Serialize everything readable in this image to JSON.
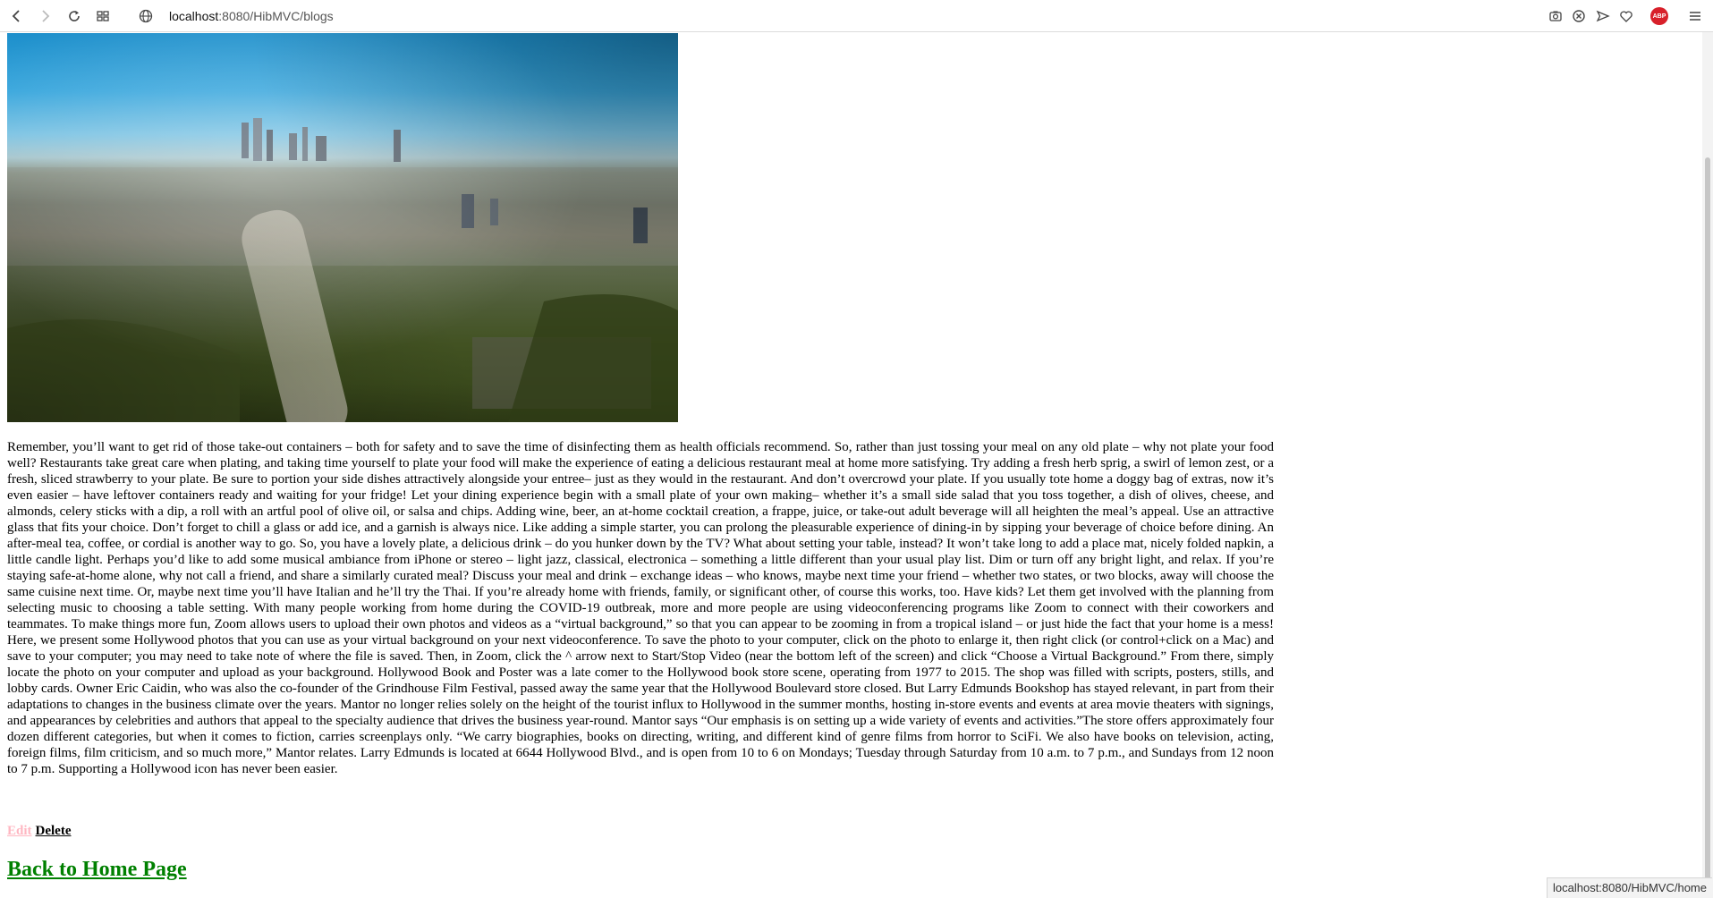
{
  "browser": {
    "url_host": "localhost",
    "url_path": ":8080/HibMVC/blogs",
    "adblock_badge": "ABP",
    "status_url": "localhost:8080/HibMVC/home"
  },
  "article": {
    "body": "Remember, you’ll want to get rid of those take-out containers – both for safety and to save the time of disinfecting them as health officials recommend. So, rather than just tossing your meal on any old plate – why not plate your food well? Restaurants take great care when plating, and taking time yourself to plate your food will make the experience of eating a delicious restaurant meal at home more satisfying. Try adding a fresh herb sprig, a swirl of lemon zest, or a fresh, sliced strawberry to your plate. Be sure to portion your side dishes attractively alongside your entree– just as they would in the restaurant. And don’t overcrowd your plate. If you usually tote home a doggy bag of extras, now it’s even easier – have leftover containers ready and waiting for your fridge! Let your dining experience begin with a small plate of your own making– whether it’s a small side salad that you toss together, a dish of olives, cheese, and almonds, celery sticks with a dip, a roll with an artful pool of olive oil, or salsa and chips. Adding wine, beer, an at-home cocktail creation, a frappe, juice, or take-out adult beverage will all heighten the meal’s appeal. Use an attractive glass that fits your choice. Don’t forget to chill a glass or add ice, and a garnish is always nice. Like adding a simple starter, you can prolong the pleasurable experience of dining-in by sipping your beverage of choice before dining. An after-meal tea, coffee, or cordial is another way to go. So, you have a lovely plate, a delicious drink – do you hunker down by the TV? What about setting your table, instead? It won’t take long to add a place mat, nicely folded napkin, a little candle light. Perhaps you’d like to add some musical ambiance from iPhone or stereo – light jazz, classical, electronica – something a little different than your usual play list. Dim or turn off any bright light, and relax. If you’re staying safe-at-home alone, why not call a friend, and share a similarly curated meal? Discuss your meal and drink – exchange ideas – who knows, maybe next time your friend – whether two states, or two blocks, away will choose the same cuisine next time. Or, maybe next time you’ll have Italian and he’ll try the Thai. If you’re already home with friends, family, or significant other, of course this works, too. Have kids? Let them get involved with the planning from selecting music to choosing a table setting. With many people working from home during the COVID-19 outbreak, more and more people are using videoconferencing programs like Zoom to connect with their coworkers and teammates. To make things more fun, Zoom allows users to upload their own photos and videos as a “virtual background,” so that you can appear to be zooming in from a tropical island – or just hide the fact that your home is a mess! Here, we present some Hollywood photos that you can use as your virtual background on your next videoconference. To save the photo to your computer, click on the photo to enlarge it, then right click (or control+click on a Mac) and save to your computer; you may need to take note of where the file is saved. Then, in Zoom, click the ^ arrow next to Start/Stop Video (near the bottom left of the screen) and click “Choose a Virtual Background.” From there, simply locate the photo on your computer and upload as your background. Hollywood Book and Poster was a late comer to the Hollywood book store scene, operating from 1977 to 2015. The shop was filled with scripts, posters, stills, and lobby cards. Owner Eric Caidin, who was also the co-founder of the Grindhouse Film Festival, passed away the same year that the Hollywood Boulevard store closed. But Larry Edmunds Bookshop has stayed relevant, in part from their adaptations to changes in the business climate over the years. Mantor no longer relies solely on the height of the tourist influx to Hollywood in the summer months, hosting in-store events and events at area movie theaters with signings, and appearances by celebrities and authors that appeal to the specialty audience that drives the business year-round. Mantor says “Our emphasis is on setting up a wide variety of events and activities.”The store offers approximately four dozen different categories, but when it comes to fiction, carries screenplays only. “We carry biographies, books on directing, writing, and different kind of genre films from horror to SciFi. We also have books on television, acting, foreign films, film criticism, and so much more,” Mantor relates. Larry Edmunds is located at 6644 Hollywood Blvd., and is open from 10 to 6 on Mondays; Tuesday through Saturday from 10 a.m. to 7 p.m., and Sundays from 12 noon to 7 p.m. Supporting a Hollywood icon has never been easier."
  },
  "actions": {
    "edit_label": "Edit",
    "delete_label": "Delete",
    "home_label": "Back to Home Page"
  },
  "colors": {
    "edit_link": "#ffb6c1",
    "home_link": "#008000",
    "abp_badge": "#d8202a"
  }
}
